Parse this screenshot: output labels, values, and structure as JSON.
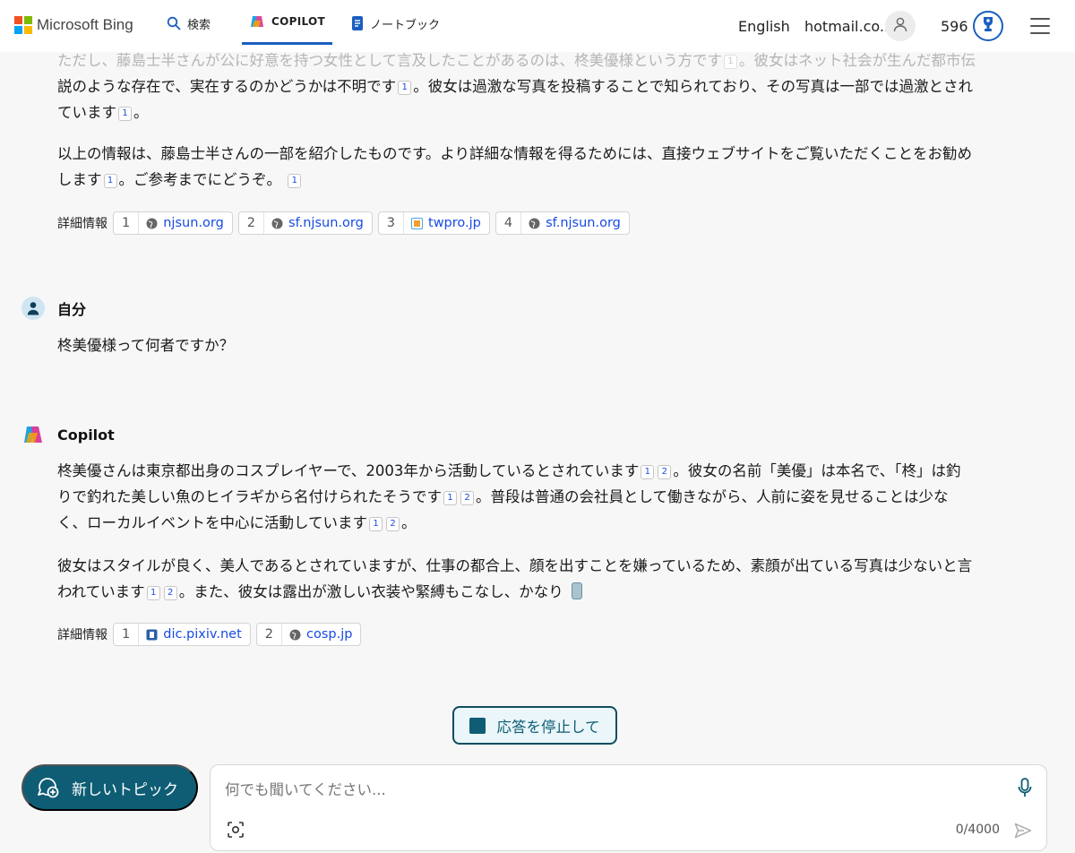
{
  "header": {
    "brand": "Microsoft Bing",
    "nav": {
      "search": "検索",
      "copilot": "COPILOT",
      "notebook": "ノートブック"
    },
    "language": "English",
    "account": "hotmail.co...",
    "points": "596"
  },
  "conversation": {
    "prev_answer": {
      "p1_faded": "ただし、藤島士半さんが公に好意を持つ女性として言及したことがあるのは、柊美優様という方です",
      "p1_faded_tail": "。彼女はネット社会が生んだ都市伝",
      "p1_line2": "説のような存在で、実在するのかどうかは不明です",
      "p1_line2_tail": "。彼女は過激な写真を投稿することで知られており、その写真は一部では過激とされ",
      "p1_line3": "ています",
      "p1_line3_tail": "。",
      "p2_a": "以上の情報は、藤島士半さんの一部を紹介したものです。より詳細な情報を得るためには、直接ウェブサイトをご覧いただくことをお勧め",
      "p2_b": "します",
      "p2_c": "。ご参考までにどうぞ。",
      "cite": "1",
      "sources_label": "詳細情報",
      "sources": [
        {
          "num": "1",
          "domain": "njsun.org"
        },
        {
          "num": "2",
          "domain": "sf.njsun.org"
        },
        {
          "num": "3",
          "domain": "twpro.jp"
        },
        {
          "num": "4",
          "domain": "sf.njsun.org"
        }
      ]
    },
    "user": {
      "name": "自分",
      "message": "柊美優様って何者ですか？"
    },
    "copilot": {
      "name": "Copilot",
      "p1_a": "柊美優さんは東京都出身のコスプレイヤーで、2003年から活動しているとされています",
      "p1_b": "。彼女の名前「美優」は本名で、「柊」は釣",
      "p1_c": "りで釣れた美しい魚のヒイラギから名付けられたそうです",
      "p1_d": "。普段は普通の会社員として働きながら、人前に姿を見せることは少な",
      "p1_e": "く、ローカルイベントを中心に活動しています",
      "p1_f": "。",
      "p2_a": "彼女はスタイルが良く、美人であるとされていますが、仕事の都合上、顔を出すことを嫌っているため、素顔が出ている写真は少ないと言",
      "p2_b": "われています",
      "p2_c": "。また、彼女は露出が激しい衣装や緊縛もこなし、かなり",
      "cite1": "1",
      "cite2": "2",
      "sources_label": "詳細情報",
      "sources": [
        {
          "num": "1",
          "domain": "dic.pixiv.net"
        },
        {
          "num": "2",
          "domain": "cosp.jp"
        }
      ]
    }
  },
  "stop_button": "応答を停止して",
  "new_topic": "新しいトピック",
  "input": {
    "placeholder": "何でも聞いてください...",
    "counter": "0/4000"
  },
  "colors": {
    "accent": "#0f5d74",
    "link": "#174ae4",
    "brand_blue": "#1a5fbf"
  }
}
